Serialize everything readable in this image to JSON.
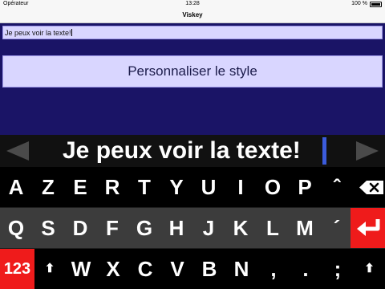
{
  "statusbar": {
    "carrier": "Opérateur",
    "time": "13:28",
    "battery": "100 %"
  },
  "navbar": {
    "title": "Viskey"
  },
  "input": {
    "value": "Je peux voir la texte!"
  },
  "style_button": {
    "label": "Personnaliser le style"
  },
  "display": {
    "text": "Je peux voir la texte!"
  },
  "keyboard": {
    "row1": [
      "A",
      "Z",
      "E",
      "R",
      "T",
      "Y",
      "U",
      "I",
      "O",
      "P",
      "ˆ"
    ],
    "row2": [
      "Q",
      "S",
      "D",
      "F",
      "G",
      "H",
      "J",
      "K",
      "L",
      "M",
      "´"
    ],
    "row3_keys": [
      "W",
      "X",
      "C",
      "V",
      "B",
      "N",
      ",",
      ".",
      ";"
    ],
    "numbers_label": "123",
    "shift_glyph": "⬆",
    "backspace_icon": "backspace-icon",
    "return_icon": "return-arrow-icon"
  },
  "colors": {
    "background": "#1a1466",
    "field": "#d9d6ff",
    "accent_red": "#ef1b1b",
    "caret_blue": "#3b5bdb"
  }
}
